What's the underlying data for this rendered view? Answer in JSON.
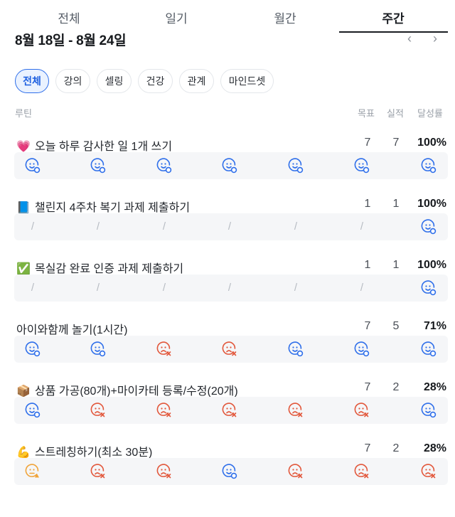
{
  "tabs": [
    {
      "label": "전체"
    },
    {
      "label": "일기"
    },
    {
      "label": "월간"
    },
    {
      "label": "주간"
    }
  ],
  "header": {
    "range": "8월 18일 - 8월 24일",
    "prev_icon": "chevron-left-icon",
    "next_icon": "chevron-right-icon",
    "prev_glyph": "‹",
    "next_glyph": "›"
  },
  "chips": [
    {
      "label": "전체",
      "active": true
    },
    {
      "label": "강의"
    },
    {
      "label": "셀링"
    },
    {
      "label": "건강"
    },
    {
      "label": "관계"
    },
    {
      "label": "마인드셋"
    }
  ],
  "columns": {
    "routine": "루틴",
    "goal": "목표",
    "actual": "실적",
    "rate": "달성률"
  },
  "colors": {
    "done": "#2f6fea",
    "missed": "#e2573b",
    "partial": "#f0a43a",
    "empty": "#b7bcc3"
  },
  "routines": [
    {
      "emoji": "💗",
      "name": "오늘 하루 감사한 일 1개 쓰기",
      "goal": "7",
      "actual": "7",
      "rate": "100%",
      "days": [
        "done",
        "done",
        "done",
        "done",
        "done",
        "done",
        "done"
      ]
    },
    {
      "emoji": "📘",
      "name": "챌린지 4주차 복기 과제 제출하기",
      "goal": "1",
      "actual": "1",
      "rate": "100%",
      "days": [
        "none",
        "none",
        "none",
        "none",
        "none",
        "none",
        "done"
      ]
    },
    {
      "emoji": "✅",
      "name": "목실감 완료 인증 과제 제출하기",
      "goal": "1",
      "actual": "1",
      "rate": "100%",
      "days": [
        "none",
        "none",
        "none",
        "none",
        "none",
        "none",
        "done"
      ]
    },
    {
      "emoji": "",
      "name": "아이와함께 놀기(1시간)",
      "goal": "7",
      "actual": "5",
      "rate": "71%",
      "days": [
        "done",
        "done",
        "missed",
        "missed",
        "done",
        "done",
        "done"
      ]
    },
    {
      "emoji": "📦",
      "name": "상품 가공(80개)+마이카테 등록/수정(20개)",
      "goal": "7",
      "actual": "2",
      "rate": "28%",
      "days": [
        "done",
        "missed",
        "missed",
        "missed",
        "missed",
        "missed",
        "done"
      ]
    },
    {
      "emoji": "💪",
      "name": "스트레칭하기(최소 30분)",
      "goal": "7",
      "actual": "2",
      "rate": "28%",
      "days": [
        "partial",
        "missed",
        "missed",
        "done",
        "missed",
        "missed",
        "missed"
      ]
    }
  ],
  "empty_day_glyph": "/"
}
